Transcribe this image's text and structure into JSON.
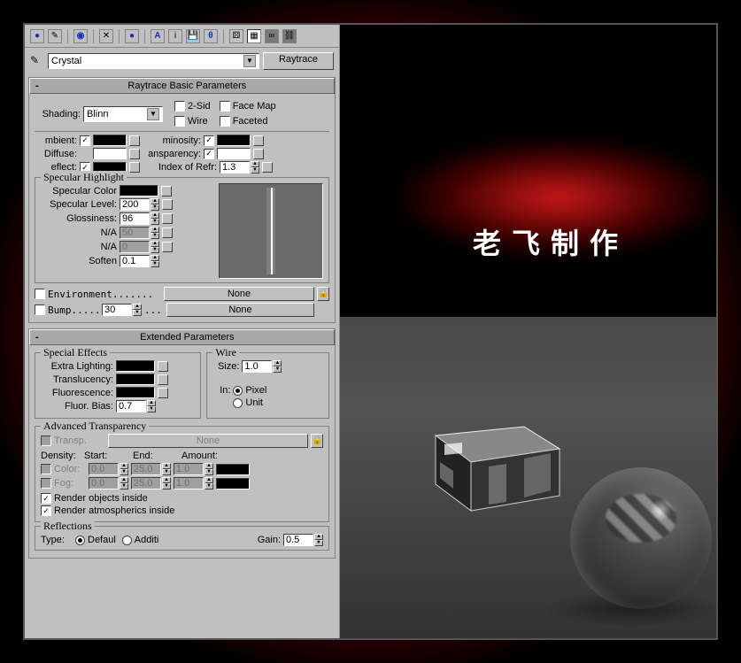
{
  "material_name": "Crystal",
  "material_type": "Raytrace",
  "toolbar_icons": [
    "sphere-icon",
    "picker-icon",
    "parent-icon",
    "x-icon",
    "sphere2-icon",
    "a-icon",
    "i-icon",
    "disk-icon",
    "theta-icon",
    "dice-icon",
    "table-icon",
    "links-icon",
    "chain-icon"
  ],
  "rollouts": {
    "basic": {
      "title": "Raytrace Basic Parameters",
      "shading_label": "Shading:",
      "shading_value": "Blinn",
      "two_sided_label": "2-Sid",
      "wire_label": "Wire",
      "face_map_label": "Face Map",
      "faceted_label": "Faceted",
      "ambient_label": "mbient:",
      "ambient_color": "#000000",
      "luminosity_label": "minosity:",
      "luminosity_color": "#000000",
      "diffuse_label": "Diffuse:",
      "diffuse_color": "#ffffff",
      "transparency_label": "ansparency:",
      "transparency_color": "#ffffff",
      "reflect_label": "eflect:",
      "reflect_color": "#000000",
      "ior_label": "Index of Refr:",
      "ior_value": "1.3",
      "spec_group": "Specular Highlight",
      "spec_color_label": "Specular Color",
      "spec_color": "#000000",
      "spec_level_label": "Specular Level:",
      "spec_level_value": "200",
      "glossiness_label": "Glossiness:",
      "glossiness_value": "96",
      "na_label": "N/A",
      "na1_value": "50",
      "na2_value": "0",
      "soften_label": "Soften",
      "soften_value": "0.1",
      "environment_label": "Environment.......",
      "environment_value": "None",
      "bump_label": "Bump......",
      "bump_spinner": "30",
      "bump_value": "None"
    },
    "extended": {
      "title": "Extended Parameters",
      "special_effects": "Special Effects",
      "extra_lighting_label": "Extra Lighting:",
      "translucency_label": "Translucency:",
      "fluorescence_label": "Fluorescence:",
      "fluor_bias_label": "Fluor. Bias:",
      "fluor_bias_value": "0.7",
      "wire_group": "Wire",
      "wire_size_label": "Size:",
      "wire_size_value": "1.0",
      "wire_in_label": "In:",
      "wire_pixels_label": "Pixel",
      "wire_units_label": "Unit",
      "adv_transp": "Advanced Transparency",
      "transp_label": "Transp.",
      "transp_value": "None",
      "density_label": "Density:",
      "start_label": "Start:",
      "end_label": "End:",
      "amount_label": "Amount:",
      "color_label": "Color:",
      "fog_label": "Fog:",
      "color_start": "0.0",
      "color_end": "25.0",
      "color_amount": "1.0",
      "fog_start": "0.0",
      "fog_end": "25.0",
      "fog_amount": "1.0",
      "render_objects_label": "Render objects inside",
      "render_atmos_label": "Render atmospherics inside",
      "reflections_group": "Reflections",
      "type_label": "Type:",
      "default_label": "Defaul",
      "additive_label": "Additi",
      "gain_label": "Gain:",
      "gain_value": "0.5"
    }
  },
  "render_text": "老飞制作",
  "colors": {
    "black": "#000000",
    "white": "#ffffff"
  }
}
